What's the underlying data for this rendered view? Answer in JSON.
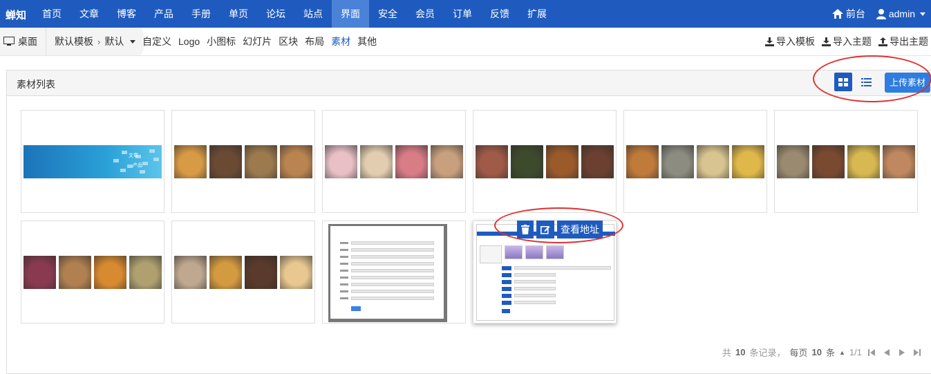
{
  "brand": "蝉知",
  "nav": [
    "首页",
    "文章",
    "博客",
    "产品",
    "手册",
    "单页",
    "论坛",
    "站点",
    "界面",
    "安全",
    "会员",
    "订单",
    "反馈",
    "扩展"
  ],
  "nav_active_index": 8,
  "top_right": {
    "front": "前台",
    "user": "admin"
  },
  "breadcrumb": {
    "desktop": "桌面",
    "template": "默认模板",
    "theme": "默认"
  },
  "subnav": [
    "自定义",
    "Logo",
    "小图标",
    "幻灯片",
    "区块",
    "布局",
    "素材",
    "其他"
  ],
  "subnav_active_index": 6,
  "subnav_right": {
    "import_template": "导入模板",
    "import_theme": "导入主题",
    "export_theme": "导出主题"
  },
  "panel": {
    "title": "素材列表",
    "upload": "上传素材"
  },
  "hover_actions": {
    "address": "查看地址"
  },
  "banner_words": [
    "文章",
    "产品"
  ],
  "tiles": [
    {
      "kind": "banner"
    },
    {
      "kind": "food",
      "colors": [
        "#d89b45",
        "#6b4a34",
        "#9c7a4e",
        "#b98450"
      ]
    },
    {
      "kind": "food",
      "colors": [
        "#e8c0c6",
        "#e3cdb0",
        "#d87c86",
        "#c8a07e"
      ]
    },
    {
      "kind": "food",
      "colors": [
        "#a05a48",
        "#3e4a2c",
        "#9a5a2a",
        "#6b4030"
      ]
    },
    {
      "kind": "food",
      "colors": [
        "#c07a3a",
        "#8c8c80",
        "#d8c490",
        "#e0b84a"
      ]
    },
    {
      "kind": "food",
      "colors": [
        "#9a8a70",
        "#7a4a30",
        "#d8b850",
        "#c08860"
      ]
    },
    {
      "kind": "food",
      "colors": [
        "#8a3a50",
        "#b08050",
        "#d88a30",
        "#b0a070"
      ]
    },
    {
      "kind": "food",
      "colors": [
        "#c0a890",
        "#d49a40",
        "#5a3a2a",
        "#e8c890"
      ]
    },
    {
      "kind": "form-shot"
    },
    {
      "kind": "settings-shot"
    }
  ],
  "pagination": {
    "total": "10",
    "per_page": "10",
    "page": "1/1",
    "text_total_pre": "共",
    "text_total_post": "条记录，",
    "text_per_pre": "每页",
    "text_per_post": "条"
  }
}
